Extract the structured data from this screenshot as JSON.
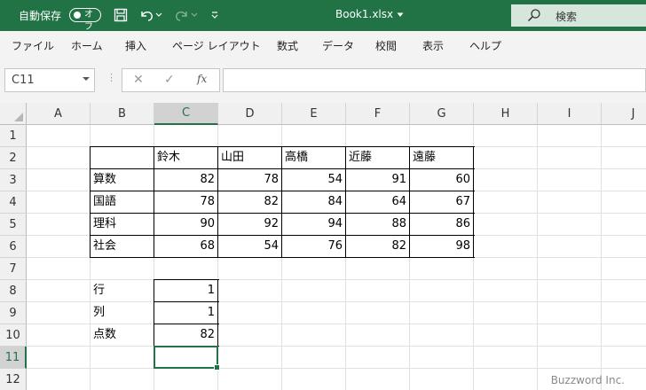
{
  "titlebar": {
    "autosave_label": "自動保存",
    "autosave_state": "オフ",
    "filename": "Book1.xlsx",
    "search_label": "検索"
  },
  "ribbon": {
    "tabs": [
      "ファイル",
      "ホーム",
      "挿入",
      "ページ レイアウト",
      "数式",
      "データ",
      "校閲",
      "表示",
      "ヘルプ"
    ]
  },
  "formula_bar": {
    "name_box": "C11",
    "fx": "fx",
    "value": ""
  },
  "columns": [
    "A",
    "B",
    "C",
    "D",
    "E",
    "F",
    "G",
    "H",
    "I",
    "J"
  ],
  "rows": [
    "1",
    "2",
    "3",
    "4",
    "5",
    "6",
    "7",
    "8",
    "9",
    "10",
    "11",
    "12"
  ],
  "table": {
    "header": [
      "鈴木",
      "山田",
      "高橋",
      "近藤",
      "遠藤"
    ],
    "rows": [
      {
        "subject": "算数",
        "values": [
          "82",
          "78",
          "54",
          "91",
          "60"
        ]
      },
      {
        "subject": "国語",
        "values": [
          "78",
          "82",
          "84",
          "64",
          "67"
        ]
      },
      {
        "subject": "理科",
        "values": [
          "90",
          "92",
          "94",
          "88",
          "86"
        ]
      },
      {
        "subject": "社会",
        "values": [
          "68",
          "54",
          "76",
          "82",
          "98"
        ]
      }
    ]
  },
  "lookup": [
    {
      "label": "行",
      "value": "1"
    },
    {
      "label": "列",
      "value": "1"
    },
    {
      "label": "点数",
      "value": "82"
    }
  ],
  "active_cell": "C11",
  "watermark": "Buzzword Inc."
}
